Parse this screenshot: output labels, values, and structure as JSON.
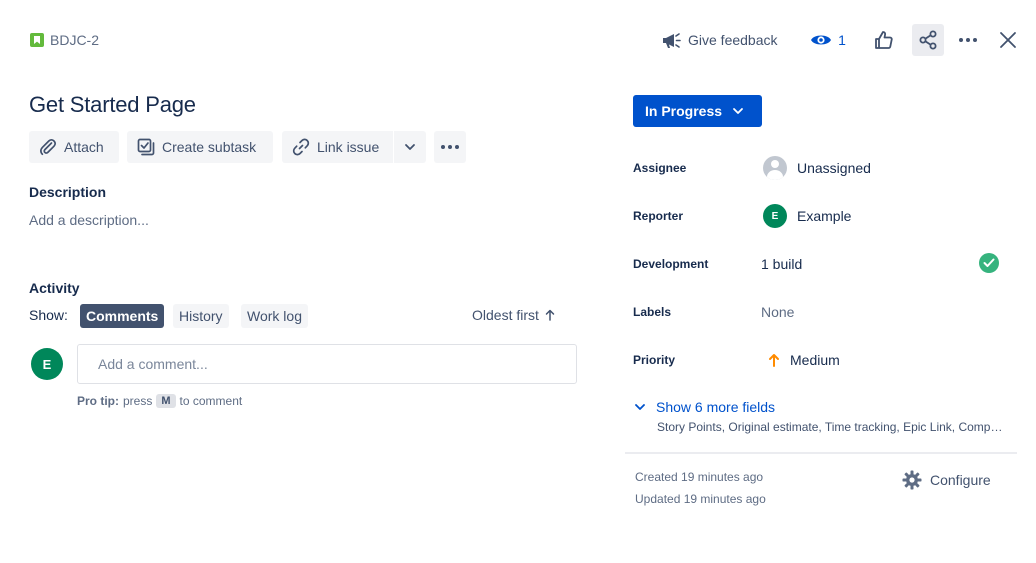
{
  "issue": {
    "key": "BDJC-2",
    "title": "Get Started Page"
  },
  "toolbar": {
    "feedback_label": "Give feedback",
    "watch_count": "1"
  },
  "actions": {
    "attach_label": "Attach",
    "create_subtask_label": "Create subtask",
    "link_issue_label": "Link issue"
  },
  "description": {
    "label": "Description",
    "placeholder": "Add a description..."
  },
  "activity": {
    "label": "Activity",
    "show_label": "Show:",
    "tabs": [
      {
        "label": "Comments",
        "active": true
      },
      {
        "label": "History",
        "active": false
      },
      {
        "label": "Work log",
        "active": false
      }
    ],
    "sort_label": "Oldest first",
    "comment_avatar_initial": "E",
    "comment_placeholder": "Add a comment...",
    "pro_tip_strong": "Pro tip:",
    "pro_tip_press": "press",
    "pro_tip_key": "M",
    "pro_tip_suffix": "to comment"
  },
  "status": {
    "label": "In Progress",
    "color": "#0052cc"
  },
  "fields": {
    "assignee": {
      "label": "Assignee",
      "value": "Unassigned"
    },
    "reporter": {
      "label": "Reporter",
      "value": "Example",
      "initial": "E"
    },
    "development": {
      "label": "Development",
      "value": "1 build"
    },
    "labels": {
      "label": "Labels",
      "value": "None"
    },
    "priority": {
      "label": "Priority",
      "value": "Medium",
      "color": "#ff8b00"
    }
  },
  "more_fields": {
    "label": "Show 6 more fields",
    "list": "Story Points, Original estimate, Time tracking, Epic Link, Components and Fix versions"
  },
  "footer": {
    "created": "Created 19 minutes ago",
    "updated": "Updated 19 minutes ago",
    "configure_label": "Configure"
  },
  "icons": {
    "issue_type": "story-icon",
    "feedback": "megaphone-icon",
    "watch": "eye-icon",
    "like": "thumbs-up-icon",
    "share": "share-icon",
    "more": "more-horizontal-icon",
    "close": "close-icon"
  }
}
